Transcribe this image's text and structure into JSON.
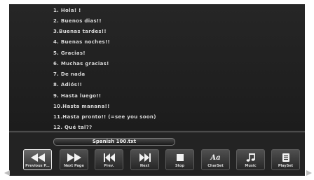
{
  "lines": [
    "1. Hola! !",
    "2. Buenos dias!!",
    "3.Buenas tardes!!",
    "4. Buenas noches!!",
    "5. Gracias!",
    "6. Muchas gracias!",
    "7. De nada",
    "8. Adiós!!",
    "9. Hasta luego!!",
    "10.Hasta manana!!",
    "11.Hasta pronto!! (=see you soon)",
    "12. Qué tal??"
  ],
  "file_name": "Spanish 100.txt",
  "toolbar": {
    "buttons": [
      {
        "label": "Previous P...",
        "icon": "rewind-icon"
      },
      {
        "label": "Next Page",
        "icon": "fast-forward-icon"
      },
      {
        "label": "Prev.",
        "icon": "skip-previous-icon"
      },
      {
        "label": "Next",
        "icon": "skip-next-icon"
      },
      {
        "label": "Stop",
        "icon": "stop-icon"
      },
      {
        "label": "CharSet",
        "icon": "charset-icon",
        "glyph": "Aa"
      },
      {
        "label": "Music",
        "icon": "music-note-icon"
      },
      {
        "label": "PlaySet",
        "icon": "playlist-settings-icon"
      }
    ]
  },
  "colors": {
    "screen_bg": "#232323",
    "text": "#d9d9d9",
    "selected_border": "#e8e8e8"
  }
}
